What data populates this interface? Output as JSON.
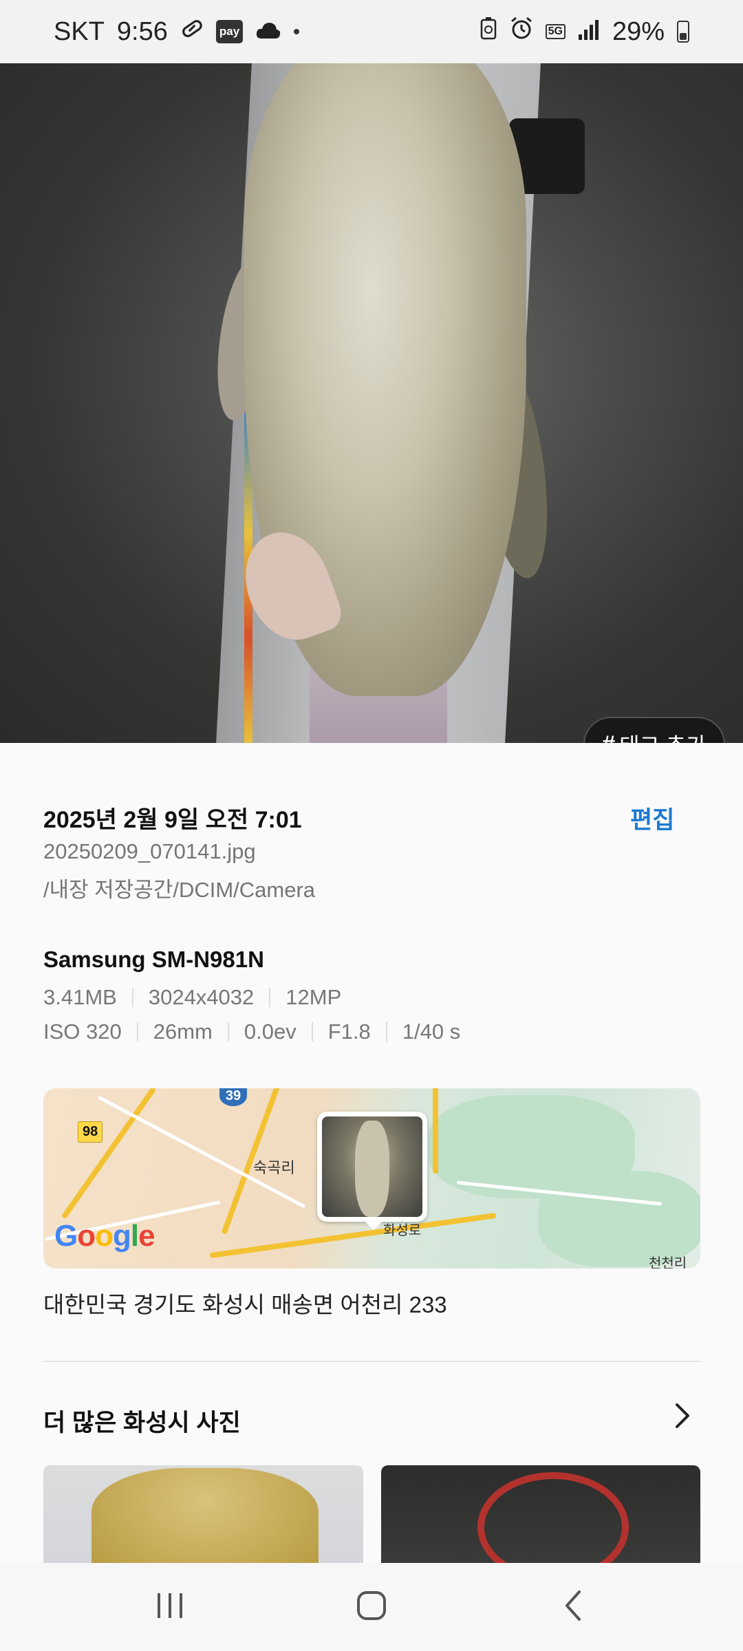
{
  "status_bar": {
    "carrier": "SKT",
    "time": "9:56",
    "pay_badge": "pay",
    "network": "5G",
    "battery": "29%"
  },
  "photo": {
    "tag_button_label": "태그 추가",
    "tag_button_symbol": "#"
  },
  "details": {
    "date_time": "2025년 2월 9일 오전 7:01",
    "edit_label": "편집",
    "filename": "20250209_070141.jpg",
    "path": "/내장 저장공간/DCIM/Camera",
    "device": "Samsung SM-N981N",
    "specs_row1": [
      "3.41MB",
      "3024x4032",
      "12MP"
    ],
    "specs_row2": [
      "ISO 320",
      "26mm",
      "0.0ev",
      "F1.8",
      "1/40 s"
    ]
  },
  "map": {
    "route_98": "98",
    "route_39": "39",
    "label_village": "숙곡리",
    "label_road": "화성로",
    "label_edge": "천천리",
    "attribution": "Google"
  },
  "address": "대한민국 경기도 화성시 매송면 어천리 233",
  "more_section": {
    "title": "더 많은 화성시 사진"
  },
  "colors": {
    "accent": "#1c7ad1",
    "text_primary": "#111111",
    "text_secondary": "#757575"
  },
  "icons": {
    "status": [
      "link-icon",
      "pay-icon",
      "cloud-icon",
      "dot-icon",
      "battery-saver-icon",
      "alarm-icon",
      "5g-icon",
      "signal-icon",
      "battery-icon"
    ],
    "nav": [
      "recents-icon",
      "home-icon",
      "back-icon"
    ]
  }
}
